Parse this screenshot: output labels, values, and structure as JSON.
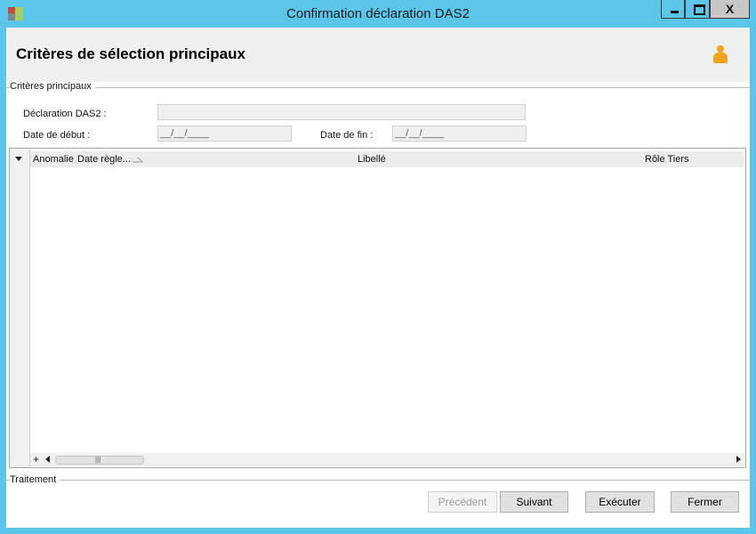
{
  "window": {
    "title": "Confirmation déclaration DAS2",
    "minimize_glyph": "_",
    "close_glyph": "X"
  },
  "header": {
    "title": "Critères de sélection principaux"
  },
  "criteria": {
    "group_label": "Critères principaux",
    "declaration_label": "Déclaration DAS2 :",
    "declaration_value": "",
    "start_label": "Date de début :",
    "start_value": "__/__/____",
    "end_label": "Date de fin :",
    "end_value": "__/__/____"
  },
  "grid": {
    "columns": [
      "Anomalie",
      "Date règle...",
      "Libellé",
      "Rôle Tiers"
    ],
    "add_row_glyph": "+",
    "scroll_grip": "|||"
  },
  "traitement": {
    "group_label": "Traitement"
  },
  "buttons": {
    "previous": "Précédent",
    "next": "Suivant",
    "execute": "Exécuter",
    "close": "Fermer"
  },
  "colors": {
    "titlebar": "#5cc6ea",
    "header_bg": "#efefef",
    "person_icon": "#f3a21c"
  }
}
